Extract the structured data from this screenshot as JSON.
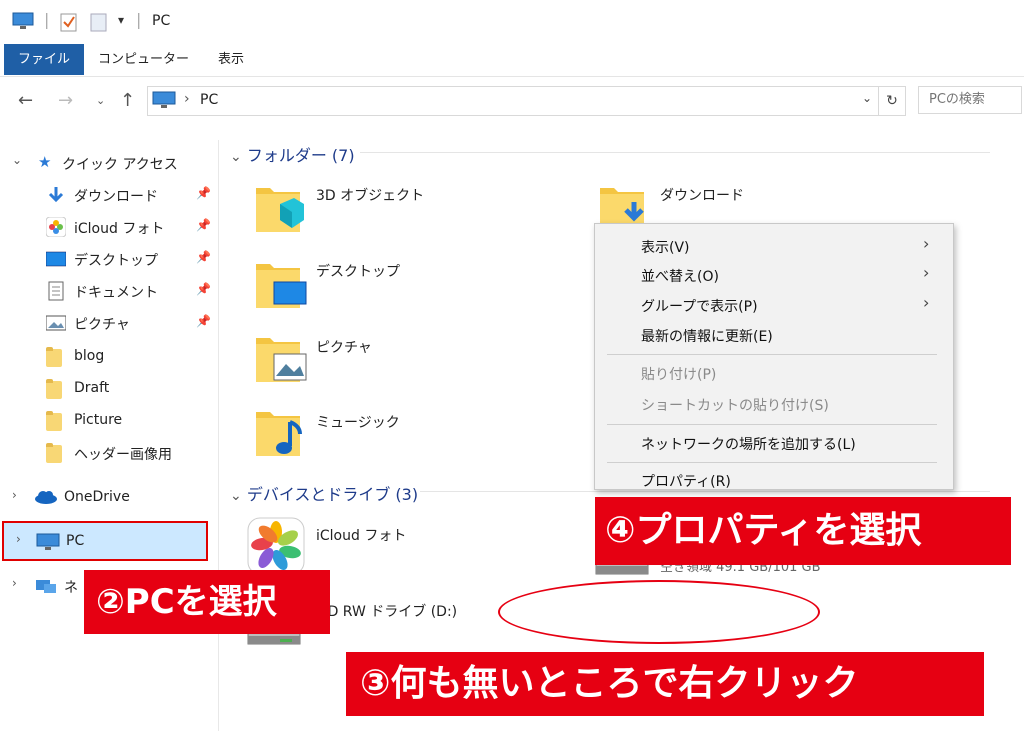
{
  "window": {
    "title": "PC",
    "ribbon_tabs": [
      "ファイル",
      "コンピューター",
      "表示"
    ]
  },
  "address": {
    "path": "PC",
    "search_placeholder": "PCの検索"
  },
  "sidebar": {
    "quick_access": "クイック アクセス",
    "items": [
      {
        "label": "ダウンロード",
        "icon": "download-icon",
        "pinned": true
      },
      {
        "label": "iCloud フォト",
        "icon": "photos-icon",
        "pinned": true
      },
      {
        "label": "デスクトップ",
        "icon": "desktop-icon",
        "pinned": true
      },
      {
        "label": "ドキュメント",
        "icon": "document-icon",
        "pinned": true
      },
      {
        "label": "ピクチャ",
        "icon": "picture-icon",
        "pinned": true
      },
      {
        "label": "blog",
        "icon": "folder-icon"
      },
      {
        "label": "Draft",
        "icon": "folder-icon"
      },
      {
        "label": "Picture",
        "icon": "folder-icon"
      },
      {
        "label": "ヘッダー画像用",
        "icon": "folder-icon"
      }
    ],
    "onedrive": "OneDrive",
    "pc": "PC",
    "network": "ネ"
  },
  "content": {
    "folders_header": "フォルダー (7)",
    "folders": [
      "3D オブジェクト",
      "ダウンロード",
      "デスクトップ",
      "ピクチャ",
      "ミュージック"
    ],
    "devices_header": "デバイスとドライブ (3)",
    "devices": [
      "iCloud フォト",
      "VD RW ドライブ (D:)"
    ],
    "drive_space": "空き領域 49.1 GB/101 GB"
  },
  "context_menu": {
    "items": [
      {
        "label": "表示(V)",
        "submenu": true
      },
      {
        "label": "並べ替え(O)",
        "submenu": true
      },
      {
        "label": "グループで表示(P)",
        "submenu": true
      },
      {
        "label": "最新の情報に更新(E)"
      },
      {
        "label": "貼り付け(P)",
        "disabled": true
      },
      {
        "label": "ショートカットの貼り付け(S)",
        "disabled": true
      },
      {
        "label": "ネットワークの場所を追加する(L)"
      },
      {
        "label": "プロパティ(R)"
      }
    ]
  },
  "annotations": {
    "step2": "②PCを選択",
    "step3": "③何も無いところで右クリック",
    "step4": "④プロパティを選択"
  },
  "colors": {
    "accent": "#1f5fa6",
    "selection": "#cce8ff",
    "annotation": "#e60012"
  }
}
